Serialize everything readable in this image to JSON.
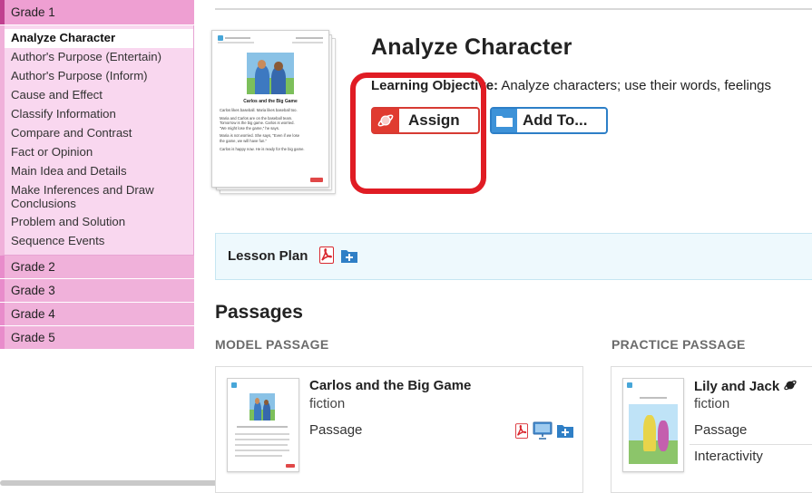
{
  "sidebar": {
    "grades": [
      {
        "label": "Grade 1"
      },
      {
        "label": "Grade 2"
      },
      {
        "label": "Grade 3"
      },
      {
        "label": "Grade 4"
      },
      {
        "label": "Grade 5"
      }
    ],
    "skills": [
      "Analyze Character",
      "Author's Purpose (Entertain)",
      "Author's Purpose (Inform)",
      "Cause and Effect",
      "Classify Information",
      "Compare and Contrast",
      "Fact or Opinion",
      "Main Idea and Details",
      "Make Inferences and Draw Conclusions",
      "Problem and Solution",
      "Sequence Events"
    ]
  },
  "worksheet": {
    "brand": "Comprehension",
    "story_title": "Carlos and the Big Game",
    "lines": [
      "Carlos likes baseball. Maria likes baseball too.",
      "Maria and Carlos are on the baseball team.",
      "Tomorrow is the big game. Carlos is worried.",
      "\"We might lose the game,\" he says.",
      "Maria is not worried. She says, \"Even if we lose",
      "the game, we will have fun.\"",
      "Carlos is happy now. He is ready for the big game."
    ]
  },
  "header": {
    "title": "Analyze Character",
    "objective_label": "Learning Objective:",
    "objective_text": " Analyze characters; use their words, feelings"
  },
  "actions": {
    "assign_label": "Assign",
    "add_label": "Add To..."
  },
  "lesson_plan": {
    "label": "Lesson Plan"
  },
  "passages": {
    "heading": "Passages",
    "model_heading": "MODEL PASSAGE",
    "practice_heading": "PRACTICE PASSAGE",
    "model": {
      "title": "Carlos and the Big Game",
      "genre": "fiction",
      "type": "Passage"
    },
    "practice": {
      "title": "Lily and Jack",
      "genre": "fiction",
      "type": "Passage",
      "extra": "Interactivity"
    }
  },
  "colors": {
    "grade_bg": "#f0b1da",
    "subnav_bg": "#f9d7ef",
    "assign_red": "#e03b30",
    "add_blue": "#3d92d8",
    "highlight": "#e01c24",
    "lesson_bg": "#eef9fd"
  }
}
